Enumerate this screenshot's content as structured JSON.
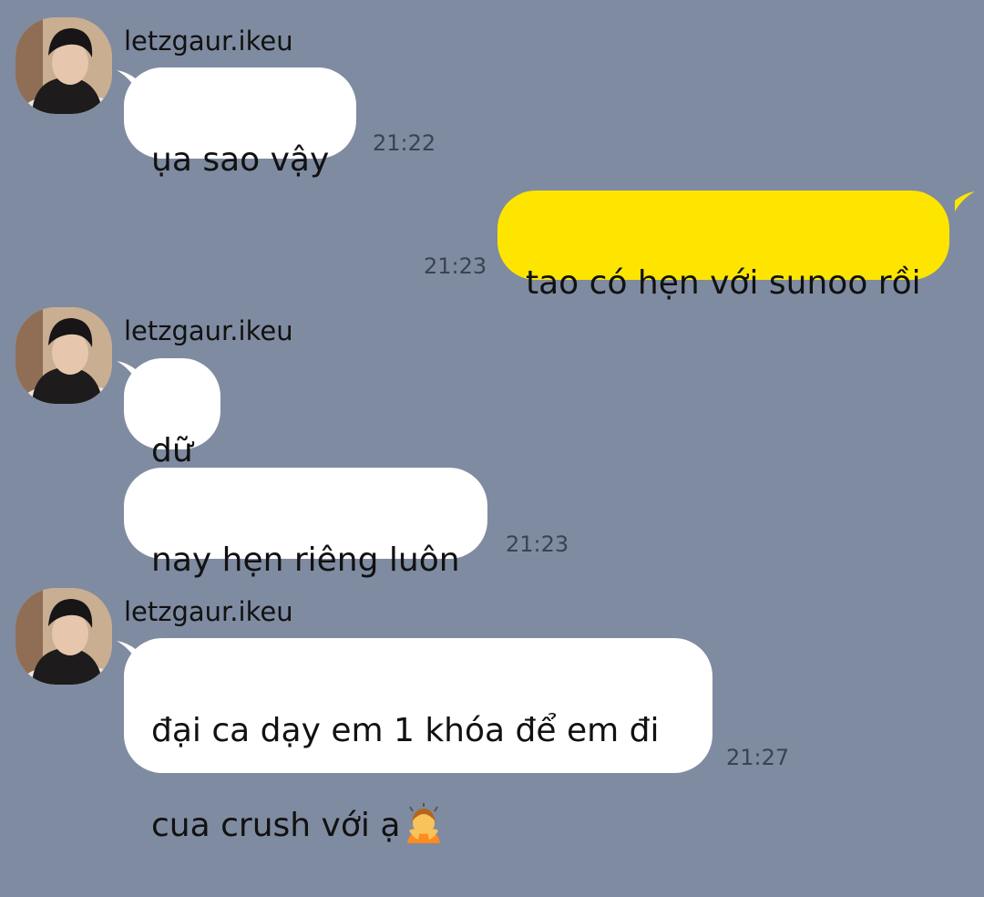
{
  "colors": {
    "background": "#7f8ba1",
    "incoming_bubble": "#ffffff",
    "outgoing_bubble": "#fee500",
    "text": "#111111",
    "timestamp": "#3b4251"
  },
  "messages": [
    {
      "sender": "letzgaur.ikeu",
      "text": "ụa sao vậy",
      "time": "21:22"
    },
    {
      "outgoing": true,
      "text": "tao có hẹn với sunoo rồi",
      "time": "21:23"
    },
    {
      "sender": "letzgaur.ikeu",
      "text": "dữ"
    },
    {
      "text": "nay hẹn riêng luôn",
      "time": "21:23"
    },
    {
      "sender": "letzgaur.ikeu",
      "text_line1": "đại ca dạy em 1 khóa để em đi",
      "text_line2": "cua crush với ạ",
      "emoji": "person-bowing-emoji",
      "time": "21:27"
    }
  ]
}
